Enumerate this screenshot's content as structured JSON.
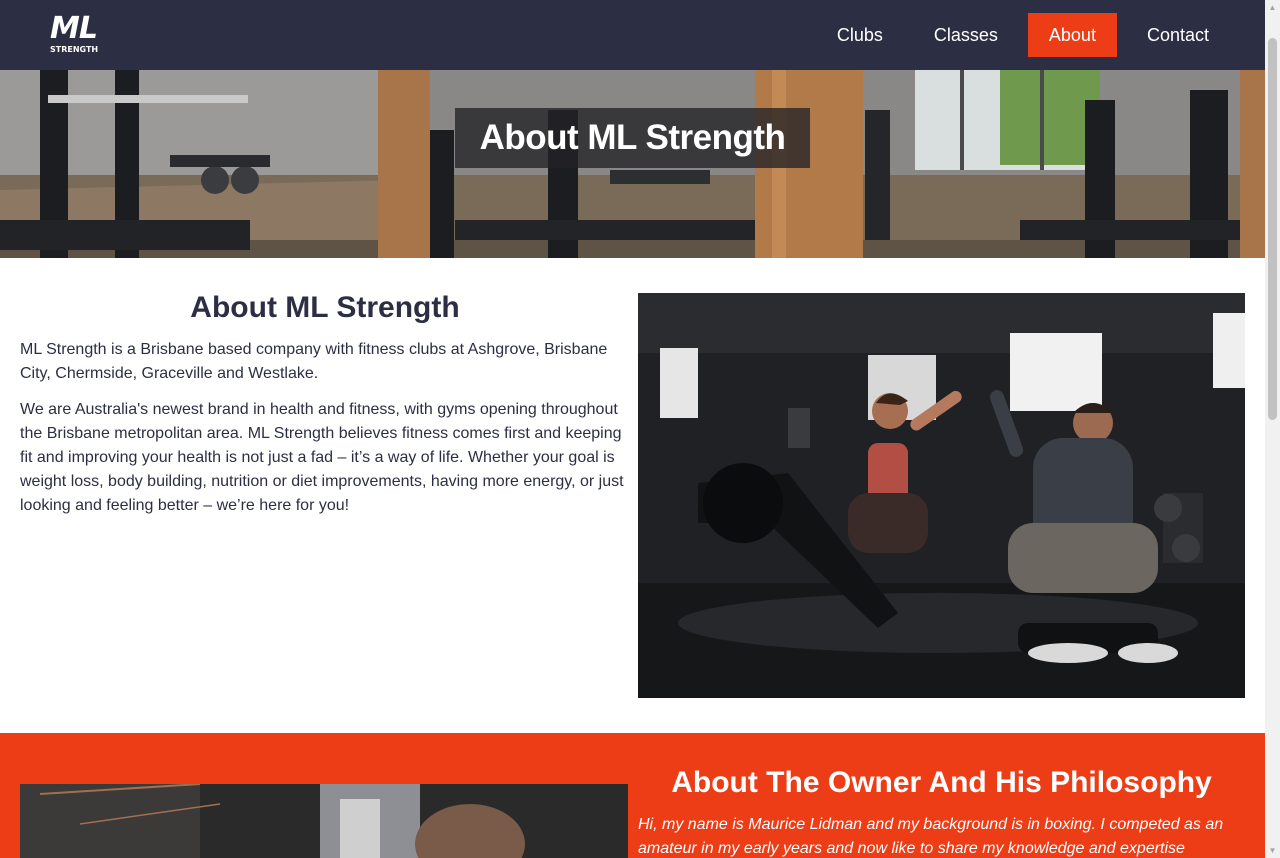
{
  "brand": {
    "logo_main": "ML",
    "logo_sub": "STRENGTH"
  },
  "nav": {
    "items": [
      {
        "label": "Clubs",
        "active": false
      },
      {
        "label": "Classes",
        "active": false
      },
      {
        "label": "About",
        "active": true
      },
      {
        "label": "Contact",
        "active": false
      }
    ]
  },
  "hero": {
    "title": "About ML Strength",
    "image": "gym-interior-photo"
  },
  "about": {
    "heading": "About ML Strength",
    "paragraphs": [
      "ML Strength is a Brisbane based company with fitness clubs at Ashgrove, Brisbane City, Chermside, Graceville and Westlake.",
      "We are Australia's newest brand in health and fitness, with gyms opening throughout the Brisbane metropolitan area. ML Strength believes fitness comes first and keeping fit and improving your health is not just a fad – it’s a way of life. Whether your goal is weight loss, body building, nutrition or diet improvements, having more energy, or just looking and feeling better – we’re here for you!"
    ],
    "image": "trainer-high-five-photo"
  },
  "owner": {
    "heading": "About The Owner And His Philosophy",
    "text": "Hi, my name is Maurice Lidman and my background is in boxing. I competed as an amateur in my early years and now like to share my knowledge and expertise",
    "image": "owner-boxing-photo"
  },
  "colors": {
    "navy": "#2c2f44",
    "accent": "#ec3d17",
    "white": "#ffffff"
  },
  "scrollbar": {
    "up_icon": "chevron-up-icon",
    "down_icon": "chevron-down-icon"
  }
}
